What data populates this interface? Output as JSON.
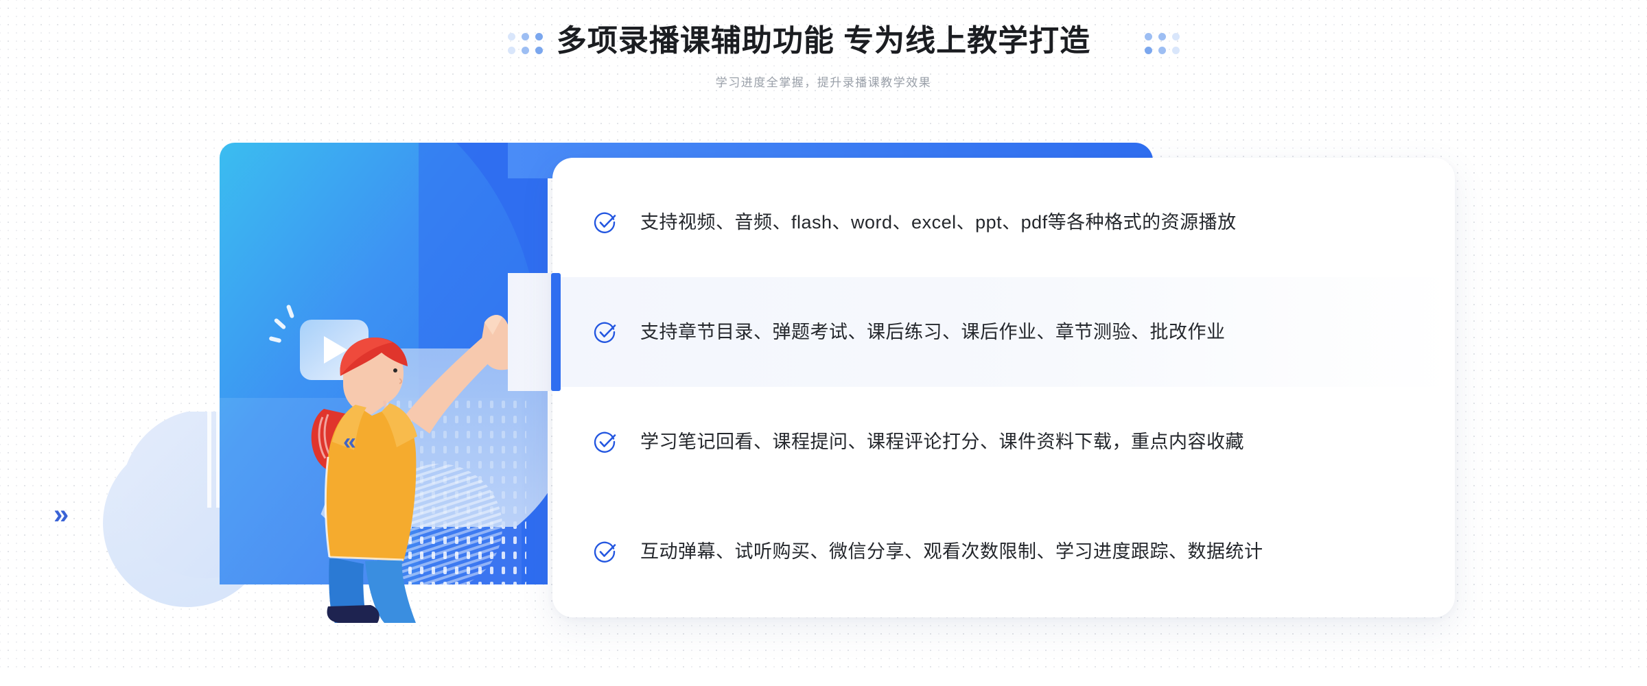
{
  "header": {
    "title": "多项录播课辅助功能 专为线上教学打造",
    "subtitle": "学习进度全掌握，提升录播课教学效果",
    "left_dots_icon": "dot-cluster-icon",
    "right_dots_icon": "dot-cluster-icon"
  },
  "illustration": {
    "name": "woman-pointing-at-video-illustration",
    "play_bubble_icon": "play-button-speech-bubble-icon",
    "chevron_left_icon": "chevron-double-left-icon",
    "chevron_right_icon": "chevron-double-right-icon"
  },
  "features": {
    "items": [
      {
        "icon": "check-circle-icon",
        "label": "支持视频、音频、flash、word、excel、ppt、pdf等各种格式的资源播放",
        "active": false
      },
      {
        "icon": "check-circle-icon",
        "label": "支持章节目录、弹题考试、课后练习、课后作业、章节测验、批改作业",
        "active": true
      },
      {
        "icon": "check-circle-icon",
        "label": "学习笔记回看、课程提问、课程评论打分、课件资料下载，重点内容收藏",
        "active": false
      },
      {
        "icon": "check-circle-icon",
        "label": "互动弹幕、试听购买、微信分享、观看次数限制、学习进度跟踪、数据统计",
        "active": false
      }
    ]
  },
  "colors": {
    "accent_blue": "#2f6ef0",
    "check_blue": "#2356e0",
    "cyan": "#3bbdf0",
    "title_text": "#1b1d21",
    "subtitle_text": "#9aa0a9",
    "body_text": "#24272c",
    "card_bg": "#ffffff",
    "highlight_row_bg": "#f3f6fd",
    "page_bg": "#ffffff",
    "dot_grid": "#d6d8dd",
    "shirt_yellow": "#f5ab2e",
    "hair_red": "#e0352c",
    "jeans_blue": "#2b7ad4",
    "shoe_navy": "#1e2350"
  }
}
